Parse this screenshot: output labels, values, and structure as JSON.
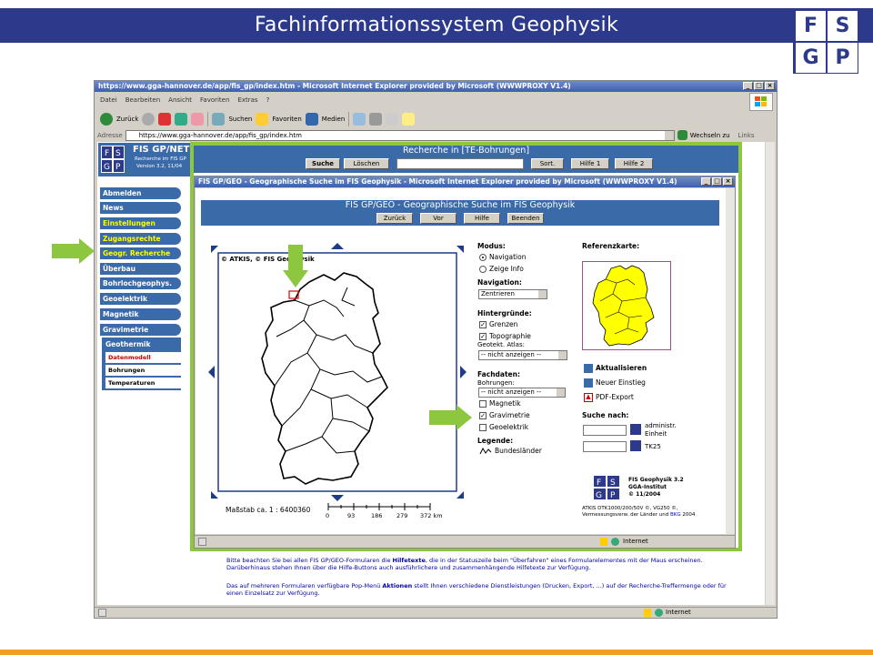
{
  "slide": {
    "title": "Fachinformationssystem Geophysik",
    "logo_letters": [
      "F",
      "S",
      "G",
      "P"
    ]
  },
  "browser": {
    "title": "https://www.gga-hannover.de/app/fis_gp/index.htm - Microsoft Internet Explorer provided by Microsoft (WWWPROXY V1.4)",
    "menu": [
      "Datei",
      "Bearbeiten",
      "Ansicht",
      "Favoriten",
      "Extras",
      "?"
    ],
    "toolbar": {
      "back": "Zurück",
      "search": "Suchen",
      "favorites": "Favoriten",
      "media": "Medien"
    },
    "address_label": "Adresse",
    "address_value": "https://www.gga-hannover.de/app/fis_gp/index.htm",
    "go_label": "Wechseln zu",
    "links_label": "Links",
    "status_zone": "Internet"
  },
  "app": {
    "logo_title": "FIS GP/NET",
    "logo_sub1": "Recherche im FIS GP",
    "logo_sub2": "Version 3.2, 11/04",
    "nav": [
      "Abmelden",
      "News",
      "Einstellungen",
      "Zugangsrechte",
      "Geogr. Recherche",
      "Überbau",
      "Bohrlochgeophys.",
      "Geoelektrik",
      "Magnetik",
      "Gravimetrie"
    ],
    "subnav_head": "Geothermik",
    "subnav": [
      "Datenmodell",
      "Bohrungen",
      "Temperaturen"
    ],
    "recherche_title": "Recherche in [TE-Bohrungen]",
    "recherche_buttons": [
      "Suche",
      "Löschen",
      "Sort.",
      "Hilfe 1",
      "Hilfe 2"
    ],
    "help_text_1a": "Bitte beachten Sie bei allen FIS GP/GEO-Formularen die ",
    "help_text_1b": "Hilfetexte",
    "help_text_1c": ", die in der Statuszeile beim \"Überfahren\" eines Formularelementes mit der Maus erscheinen. Darüberhinaus stehen Ihnen über die Hilfe-Buttons auch ausführlichere und zusammenhängende Hilfetexte zur Verfügung.",
    "help_text_2a": "Das auf mehreren Formularen verfügbare Pop-Menü ",
    "help_text_2b": "Aktionen",
    "help_text_2c": " stellt Ihnen verschiedene Dienstleistungen (Drucken, Export, ...) auf der Recherche-Treffermenge oder für einen Einzelsatz zur Verfügung."
  },
  "popup": {
    "title": "FIS GP/GEO - Geographische Suche im FIS Geophysik - Microsoft Internet Explorer provided by Microsoft (WWWPROXY V1.4)",
    "heading": "FIS GP/GEO - Geographische Suche im FIS Geophysik",
    "buttons": [
      "Zurück",
      "Vor",
      "Hilfe",
      "Beenden"
    ],
    "copyright": "© ATKIS, © FIS Geophysik",
    "scale_label": "Maßstab ca. 1 : 6400360",
    "scale_ticks": [
      "0",
      "93",
      "186",
      "279",
      "372 km"
    ],
    "modus_label": "Modus:",
    "modus_opts": [
      "Navigation",
      "Zeige Info"
    ],
    "navigation_label": "Navigation:",
    "navigation_value": "Zentrieren",
    "hintergruende_label": "Hintergründe:",
    "hintergruende": [
      "Grenzen",
      "Topographie"
    ],
    "atlas_label": "Geotekt. Atlas:",
    "atlas_value": "-- nicht anzeigen --",
    "fachdaten_label": "Fachdaten:",
    "bohrungen_label": "Bohrungen:",
    "bohrungen_value": "-- nicht anzeigen --",
    "fachdaten": [
      "Magnetik",
      "Gravimetrie",
      "Geoelektrik"
    ],
    "legende_label": "Legende:",
    "legende_item": "Bundesländer",
    "refkarte_label": "Referenzkarte:",
    "actions": [
      "Aktualisieren",
      "Neuer Einstieg",
      "PDF-Export"
    ],
    "suche_nach_label": "Suche nach:",
    "suche_admin": "administr. Einheit",
    "suche_tk": "TK25",
    "fis_info_1": "FIS Geophysik 3.2",
    "fis_info_2": "GGA-Institut",
    "fis_info_3": "© 11/2004",
    "atkis_note_1": "ATKIS DTK1000/200/50V ©, VG250 ©,",
    "atkis_note_2a": "Vermessungsverw. der Länder und ",
    "atkis_note_2b": "BKG",
    "atkis_note_2c": " 2004",
    "status_zone": "Internet"
  },
  "colors": {
    "header_blue": "#2d3a8c",
    "highlight_green": "#8dc63f",
    "nav_blue": "#3b6aa8",
    "map_yellow": "#ffff00",
    "bottom_bar": "#f0a020"
  }
}
